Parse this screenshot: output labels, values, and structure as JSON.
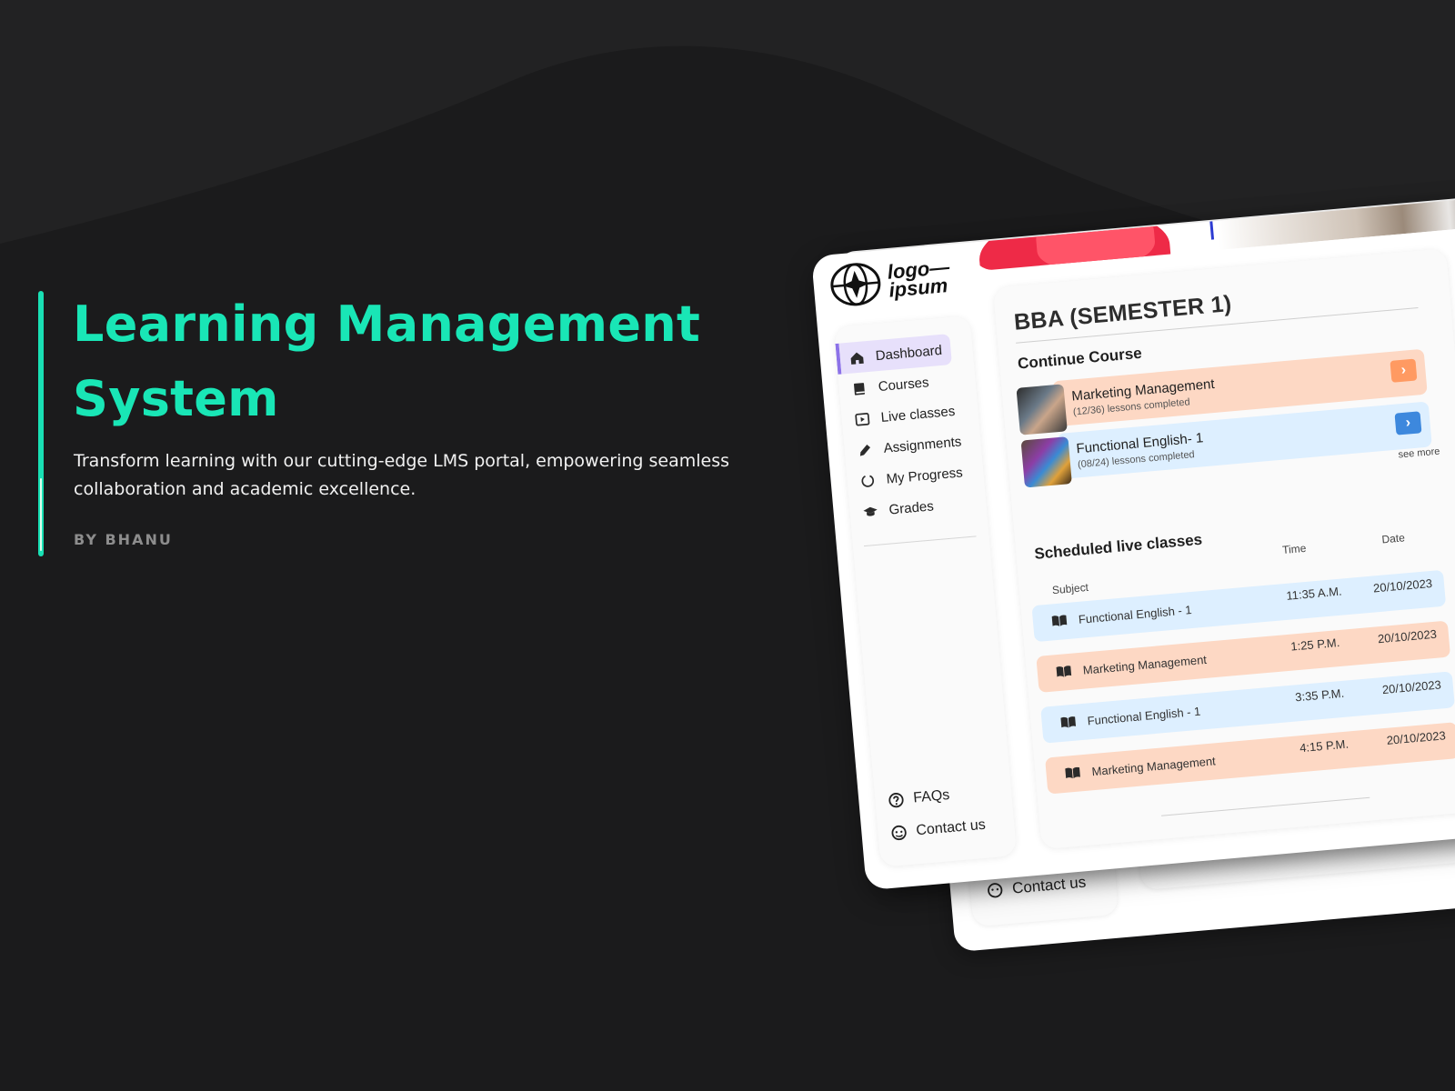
{
  "hero": {
    "title": "Learning Management System",
    "description": "Transform learning with our cutting-edge LMS portal, empowering seamless collaboration and academic excellence.",
    "byline": "BY BHANU"
  },
  "colors": {
    "background": "#1b1b1c",
    "accent": "#19e6b6",
    "peach_row": "#fdd8c4",
    "blue_row": "#ddefff",
    "nav_active": "#e7e0fb"
  },
  "app": {
    "logo_text": "logo—\nipsum",
    "sidebar": {
      "items": [
        {
          "label": "Dashboard",
          "icon": "home-icon",
          "active": true
        },
        {
          "label": "Courses",
          "icon": "book-icon",
          "active": false
        },
        {
          "label": "Live classes",
          "icon": "play-icon",
          "active": false
        },
        {
          "label": "Assignments",
          "icon": "pencil-icon",
          "active": false
        },
        {
          "label": "My Progress",
          "icon": "progress-circle-icon",
          "active": false
        },
        {
          "label": "Grades",
          "icon": "graduation-cap-icon",
          "active": false
        }
      ],
      "bottom": [
        {
          "label": "FAQs",
          "icon": "question-icon"
        },
        {
          "label": "Contact us",
          "icon": "support-icon"
        }
      ]
    },
    "main": {
      "title": "BBA (SEMESTER 1)",
      "continue_title": "Continue Course",
      "courses": [
        {
          "name": "Marketing Management",
          "progress_text": "(12/36) lessons completed",
          "theme": "peach"
        },
        {
          "name": "Functional English- 1",
          "progress_text": "(08/24) lessons completed",
          "theme": "blue"
        }
      ],
      "see_more": "see more",
      "schedule_title": "Scheduled live classes",
      "schedule_headers": {
        "subject": "Subject",
        "time": "Time",
        "date": "Date"
      },
      "schedule": [
        {
          "subject": "Functional English - 1",
          "time": "11:35 A.M.",
          "date": "20/10/2023",
          "theme": "blue"
        },
        {
          "subject": "Marketing Management",
          "time": "1:25 P.M.",
          "date": "20/10/2023",
          "theme": "peach"
        },
        {
          "subject": "Functional English - 1",
          "time": "3:35 P.M.",
          "date": "20/10/2023",
          "theme": "blue"
        },
        {
          "subject": "Marketing Management",
          "time": "4:15 P.M.",
          "date": "20/10/2023",
          "theme": "peach"
        }
      ]
    },
    "back_sheets": {
      "contact_label": "Contact us"
    }
  }
}
